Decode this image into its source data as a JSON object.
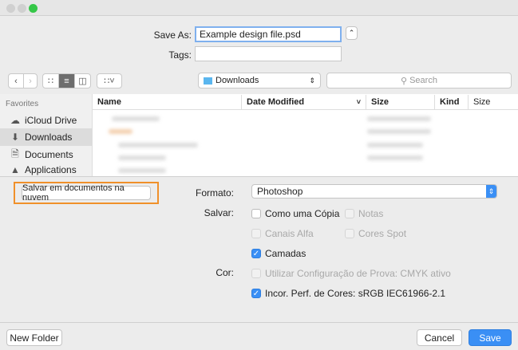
{
  "window": {
    "save_as_label": "Save As:",
    "file_name": "Example design file.psd",
    "tags_label": "Tags:",
    "tags_value": ""
  },
  "toolbar": {
    "location": "Downloads",
    "search_placeholder": "Search"
  },
  "sidebar": {
    "section": "Favorites",
    "items": [
      {
        "label": "iCloud Drive",
        "icon": "cloud-icon"
      },
      {
        "label": "Downloads",
        "icon": "download-icon"
      },
      {
        "label": "Documents",
        "icon": "document-icon"
      },
      {
        "label": "Applications",
        "icon": "applications-icon"
      }
    ]
  },
  "columns": [
    "Name",
    "Date Modified",
    "Size",
    "Kind",
    "Size"
  ],
  "options": {
    "cloud_button": "Salvar em documentos na nuvem",
    "format_label": "Formato:",
    "format_value": "Photoshop",
    "save_label": "Salvar:",
    "color_label": "Cor:",
    "checkboxes": [
      {
        "label": "Como uma Cópia",
        "checked": false,
        "enabled": true
      },
      {
        "label": "Notas",
        "checked": false,
        "enabled": false
      },
      {
        "label": "Canais Alfa",
        "checked": false,
        "enabled": false
      },
      {
        "label": "Cores Spot",
        "checked": false,
        "enabled": false
      },
      {
        "label": "Camadas",
        "checked": true,
        "enabled": true
      },
      {
        "label": "Utilizar Configuração de Prova: CMYK ativo",
        "checked": false,
        "enabled": false
      },
      {
        "label": "Incor. Perf. de Cores: sRGB IEC61966-2.1",
        "checked": true,
        "enabled": true
      }
    ]
  },
  "footer": {
    "new_folder": "New Folder",
    "cancel": "Cancel",
    "save": "Save"
  },
  "colors": {
    "accent": "#3a8ff5",
    "highlight": "#f0902a"
  }
}
